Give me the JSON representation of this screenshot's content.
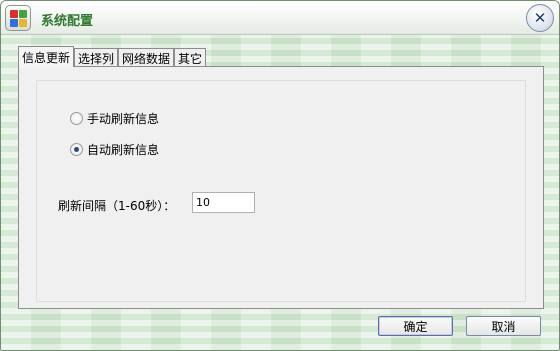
{
  "window": {
    "title": "系统配置",
    "close_glyph": "✕"
  },
  "tabs": [
    {
      "label": "信息更新",
      "active": true
    },
    {
      "label": "选择列",
      "active": false
    },
    {
      "label": "网络数据",
      "active": false
    },
    {
      "label": "其它",
      "active": false
    }
  ],
  "refresh": {
    "manual_label": "手动刷新信息",
    "auto_label": "自动刷新信息",
    "selected": "auto",
    "interval_label": "刷新间隔（1-60秒）：",
    "interval_value": "10"
  },
  "buttons": {
    "ok_label": "确定",
    "cancel_label": "取消"
  },
  "colors": {
    "title_text": "#2f7a2f",
    "background_tint": "#d7ebd7"
  },
  "icons": {
    "app": "app-grid-icon",
    "close": "close-icon"
  }
}
